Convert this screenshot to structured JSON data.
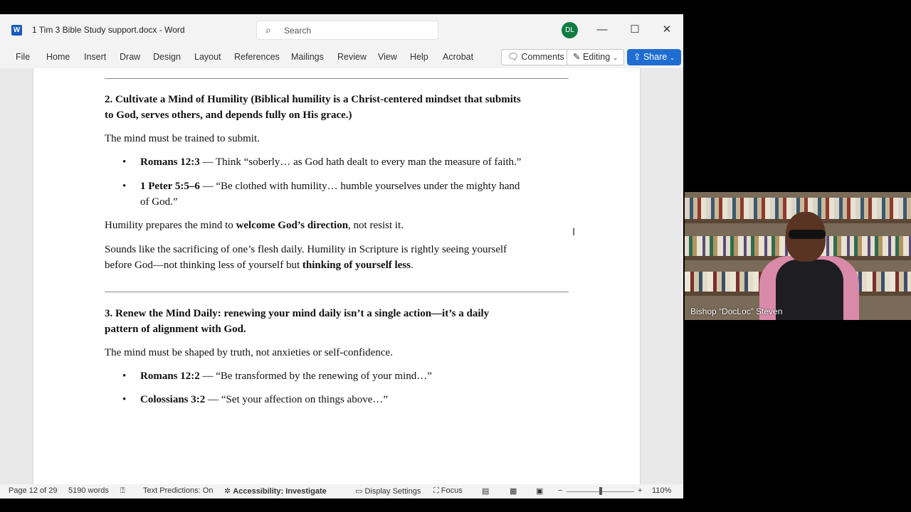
{
  "window": {
    "doc_title": "1 Tim 3 Bible Study support.docx",
    "app_name": "Word",
    "title_sep": "-",
    "search_placeholder": "Search",
    "avatar_initials": "DL"
  },
  "ribbon": {
    "tabs": [
      "File",
      "Home",
      "Insert",
      "Draw",
      "Design",
      "Layout",
      "References",
      "Mailings",
      "Review",
      "View",
      "Help",
      "Acrobat"
    ],
    "comments_label": "Comments",
    "editing_label": "Editing",
    "share_label": "Share"
  },
  "document": {
    "section2": {
      "heading_line1": "2. Cultivate a Mind of Humility (Biblical humility is a Christ-centered mindset that submits",
      "heading_line2": "to God, serves others, and depends fully on His grace.)",
      "intro": "The mind must be trained to submit.",
      "b1_ref": "Romans 12:3",
      "b1_text": " — Think “soberly… as God hath dealt to every man the measure of faith.”",
      "b2_ref": "1 Peter 5:5–6",
      "b2_text_line1": " — “Be clothed with humility… humble yourselves under the mighty hand",
      "b2_text_line2": "of God.”",
      "p2_a": "Humility prepares the mind to ",
      "p2_b": "welcome God’s direction",
      "p2_c": ", not resist it.",
      "p3_line1": "Sounds like the sacrificing of one’s flesh daily. Humility in Scripture is rightly seeing yourself",
      "p3_line2a": "before God—not thinking less of yourself but ",
      "p3_line2b": "thinking of yourself less",
      "p3_line2c": "."
    },
    "section3": {
      "heading_line1": "3. Renew the Mind Daily: renewing your mind daily isn’t a single action—it’s a daily",
      "heading_line2": "pattern of alignment with God.",
      "intro": "The mind must be shaped by truth, not anxieties or self-confidence.",
      "b1_ref": "Romans 12:2",
      "b1_text": " — “Be transformed by the renewing of your mind…”",
      "b2_ref": "Colossians 3:2",
      "b2_text": " — “Set your affection on things above…”"
    }
  },
  "status": {
    "page": "Page 12 of 29",
    "words": "5190 words",
    "predictions": "Text Predictions: On",
    "accessibility": "Accessibility: Investigate",
    "display": "Display Settings",
    "focus": "Focus",
    "zoom_minus": "−",
    "zoom_plus": "+",
    "zoom": "110%",
    "zoom_fraction": 0.5
  },
  "video": {
    "participant_name": "Bishop “DocLoc” Steven"
  },
  "colors": {
    "accent": "#1f6dd1",
    "avatar": "#107c41",
    "word_blue": "#185abd"
  }
}
